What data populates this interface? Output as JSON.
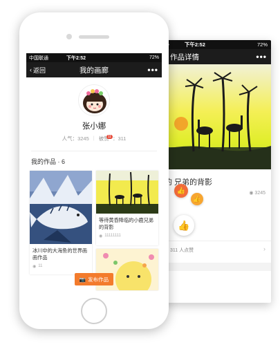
{
  "front": {
    "status": {
      "carrier": "中国联通",
      "time": "下午2:52",
      "battery": "72%"
    },
    "nav": {
      "back_label": "返回",
      "title": "我的画廊"
    },
    "profile": {
      "name": "张小娜",
      "popularity_label": "人气",
      "popularity_value": "3245",
      "likes_label": "被赞",
      "likes_value": "311",
      "likes_badge": "11"
    },
    "works_title": "我的作品 · 6",
    "works": [
      {
        "caption": "冰川中的大海鱼的世界画 画作品",
        "views": "11"
      },
      {
        "caption": "等待黄昏降临的小鹿兄弟 的背影",
        "views": "11111111"
      }
    ],
    "publish_label": "发布作品"
  },
  "back": {
    "status": {
      "time": "下午2:52",
      "battery": "72%"
    },
    "nav": {
      "title": "作品详情"
    },
    "title": "的 兄弟的背影",
    "views": "3245",
    "likes_text": "311 人点赞"
  },
  "colors": {
    "accent": "#f37b2c",
    "nav_bg": "#1c1c1c",
    "badge": "#e64b3b"
  },
  "icons": [
    "chevron-left-icon",
    "more-icon",
    "eye-icon",
    "camera-icon",
    "thumbs-up-icon",
    "chevron-right-icon"
  ]
}
